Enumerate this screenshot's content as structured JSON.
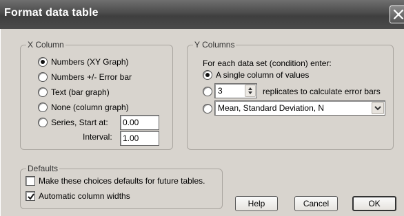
{
  "window": {
    "title": "Format data table"
  },
  "x_column": {
    "legend": "X Column",
    "options": [
      {
        "label": "Numbers (XY Graph)",
        "checked": true
      },
      {
        "label": "Numbers +/- Error bar",
        "checked": false
      },
      {
        "label": "Text (bar graph)",
        "checked": false
      },
      {
        "label": "None (column graph)",
        "checked": false
      },
      {
        "label": "Series, Start at:",
        "checked": false
      }
    ],
    "start_value": "0.00",
    "interval_label": "Interval:",
    "interval_value": "1.00"
  },
  "y_columns": {
    "legend": "Y Columns",
    "instruction": "For each data set (condition) enter:",
    "single_label": "A single column of values",
    "single_checked": true,
    "replicates_value": "3",
    "replicates_label": "replicates to calculate error bars",
    "replicates_checked": false,
    "summary_checked": false,
    "summary_selected": "Mean, Standard Deviation, N"
  },
  "defaults": {
    "legend": "Defaults",
    "make_default_label": "Make these choices defaults for future tables.",
    "make_default_checked": false,
    "auto_width_label": "Automatic column widths",
    "auto_width_checked": true
  },
  "buttons": {
    "help": "Help",
    "cancel": "Cancel",
    "ok": "OK"
  }
}
